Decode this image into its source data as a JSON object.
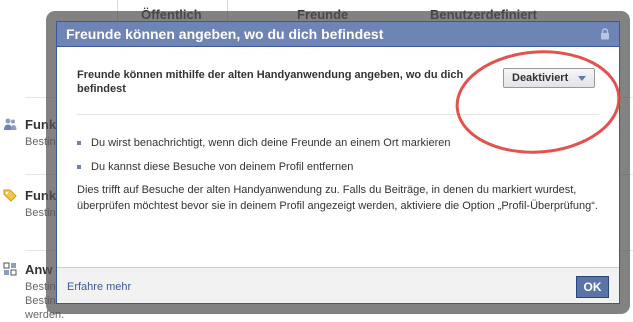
{
  "background": {
    "tabs": [
      "Öffentlich",
      "Freunde",
      "Benutzerdefiniert"
    ],
    "rows": [
      {
        "title": "Funk",
        "desc": "Bestin"
      },
      {
        "title": "Funk",
        "desc": "Bestin"
      },
      {
        "title": "Anw",
        "desc_lines": [
          "Bestin",
          "Bestin",
          "werden."
        ]
      }
    ]
  },
  "dialog": {
    "title": "Freunde können angeben, wo du dich befindest",
    "setting_label": "Freunde können mithilfe der alten Handyanwendung angeben, wo du dich befindest",
    "select_value": "Deaktiviert",
    "bullets": [
      "Du wirst benachrichtigt, wenn dich deine Freunde an einem Ort markieren",
      "Du kannst diese Besuche von deinem Profil entfernen"
    ],
    "description": "Dies trifft auf Besuche der alten Handyanwendung zu. Falls du Beiträge, in denen du markiert wurdest, überprüfen möchtest bevor sie in deinem Profil angezeigt werden, aktiviere die Option „Profil-Überprüfung“.",
    "learn_more": "Erfahre mehr",
    "ok": "OK"
  },
  "colors": {
    "header_bg": "#6d84b4",
    "border": "#3b5998",
    "link": "#3b5998",
    "annotation": "#e0403a"
  },
  "icons": [
    "lock-icon",
    "dropdown-arrow-icon",
    "people-icon",
    "tag-icon",
    "apps-icon"
  ]
}
